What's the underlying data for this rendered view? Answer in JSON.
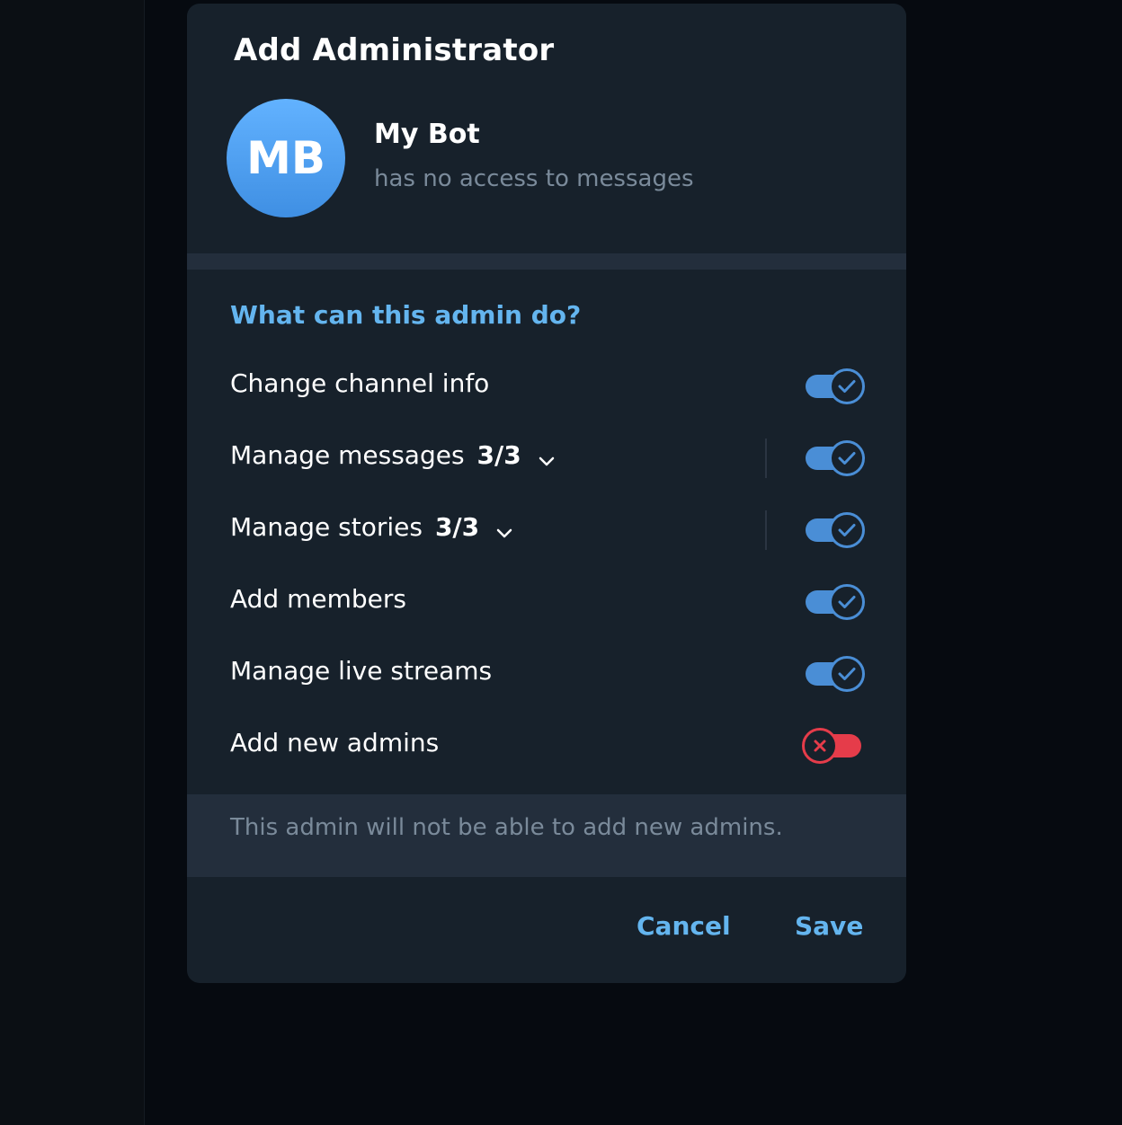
{
  "dialog": {
    "title": "Add Administrator",
    "user": {
      "initials": "MB",
      "name": "My Bot",
      "status": "has no access to messages"
    },
    "section_title": "What can this admin do?",
    "permissions": [
      {
        "label": "Change channel info",
        "count": "",
        "expandable": false,
        "enabled": true
      },
      {
        "label": "Manage messages",
        "count": "3/3",
        "expandable": true,
        "enabled": true
      },
      {
        "label": "Manage stories",
        "count": "3/3",
        "expandable": true,
        "enabled": true
      },
      {
        "label": "Add members",
        "count": "",
        "expandable": false,
        "enabled": true
      },
      {
        "label": "Manage live streams",
        "count": "",
        "expandable": false,
        "enabled": true
      },
      {
        "label": "Add new admins",
        "count": "",
        "expandable": false,
        "enabled": false
      }
    ],
    "note": "This admin will not be able to add new admins.",
    "cancel_label": "Cancel",
    "save_label": "Save"
  },
  "colors": {
    "accent": "#64b5ef",
    "toggle_on": "#4a8ed6",
    "toggle_off": "#e53c4a",
    "background": "#17212b"
  }
}
